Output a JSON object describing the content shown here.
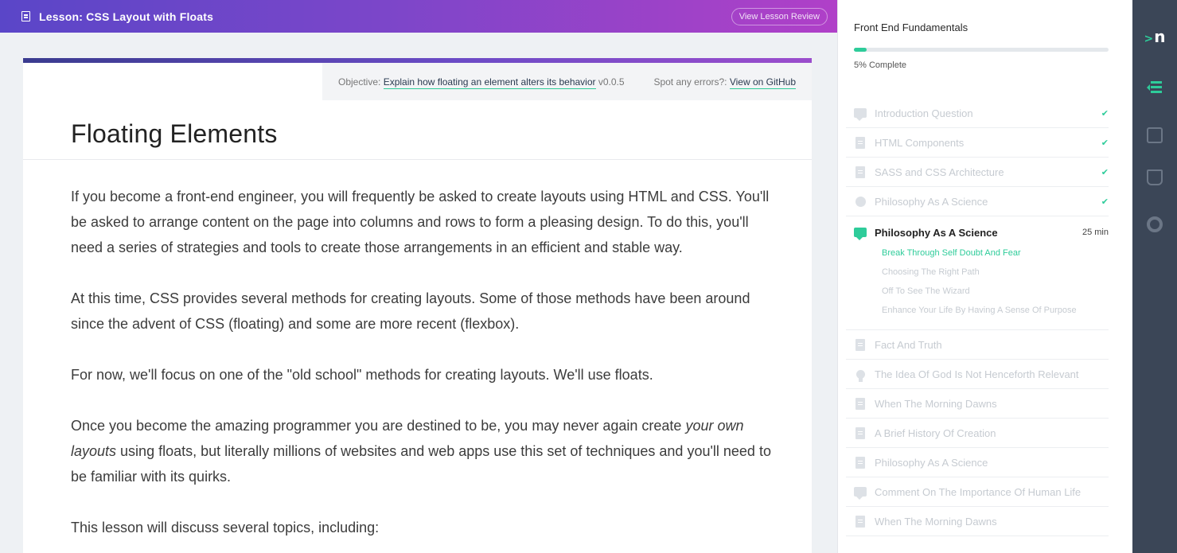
{
  "header": {
    "title": "Lesson: CSS Layout with Floats",
    "review_button": "View Lesson Review"
  },
  "objective": {
    "label": "Objective:",
    "link": "Explain how floating an element alters its behavior",
    "version": "v0.0.5",
    "errors_label": "Spot any errors?:",
    "github_link": "View on GitHub"
  },
  "lesson": {
    "heading": "Floating Elements",
    "paragraphs": [
      "If you become a front-end engineer, you will frequently be asked to create layouts using HTML and CSS. You'll be asked to arrange content on the page into columns and rows to form a pleasing design. To do this, you'll need a series of strategies and tools to create those arrangements in an efficient and stable way.",
      "At this time, CSS provides several methods for creating layouts. Some of those methods have been around since the advent of CSS (floating) and some are more recent (flexbox).",
      "For now, we'll focus on one of the \"old school\" methods for creating layouts. We'll use floats.",
      "This lesson will discuss several topics, including:"
    ],
    "p4_before": "Once you become the amazing programmer you are destined to be, you may never again create ",
    "p4_em": "your own layouts",
    "p4_after": " using floats, but literally millions of websites and web apps use this set of techniques and you'll need to be familiar with its quirks."
  },
  "sidebar": {
    "course_title": "Front End Fundamentals",
    "progress_fraction": 0.05,
    "complete_text": "5% Complete",
    "lessons_done": [
      {
        "label": "Introduction Question",
        "icon": "chat-icon"
      },
      {
        "label": "HTML Components",
        "icon": "document-icon"
      },
      {
        "label": "SASS and CSS Architecture",
        "icon": "document-icon"
      },
      {
        "label": "Philosophy As A Science",
        "icon": "apple-icon"
      }
    ],
    "active": {
      "label": "Philosophy As A Science",
      "duration": "25 min",
      "icon": "chat-icon",
      "subitems": [
        "Break Through Self Doubt And Fear",
        "Choosing The Right Path",
        "Off To See The Wizard",
        "Enhance Your Life By Having A Sense Of Purpose"
      ]
    },
    "lessons_upcoming": [
      {
        "label": "Fact And Truth",
        "icon": "document-icon"
      },
      {
        "label": "The Idea Of God Is Not Henceforth Relevant",
        "icon": "lightbulb-icon"
      },
      {
        "label": "When The Morning Dawns",
        "icon": "document-icon"
      },
      {
        "label": "A Brief History Of Creation",
        "icon": "document-icon"
      },
      {
        "label": "Philosophy As A Science",
        "icon": "document-icon"
      },
      {
        "label": "Comment On The Importance Of Human Life",
        "icon": "chat-icon"
      },
      {
        "label": "When The Morning Dawns",
        "icon": "document-icon"
      }
    ]
  },
  "rail": {
    "logo": "n",
    "icons": [
      "course-outline-icon",
      "terminal-icon",
      "book-icon",
      "help-ring-icon"
    ]
  },
  "colors": {
    "accent": "#2ecc9a",
    "header_start": "#5a46c8",
    "header_end": "#b040c8",
    "rail": "#3b4657"
  }
}
